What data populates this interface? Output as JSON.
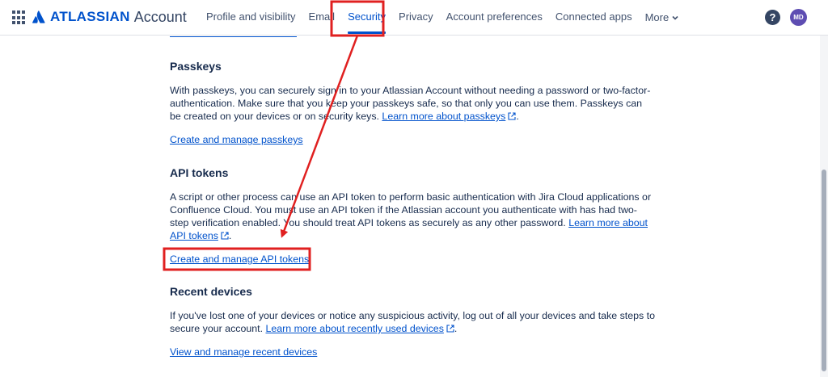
{
  "header": {
    "brand": "ATLASSIAN",
    "product": "Account",
    "nav": [
      {
        "label": "Profile and visibility"
      },
      {
        "label": "Email"
      },
      {
        "label": "Security"
      },
      {
        "label": "Privacy"
      },
      {
        "label": "Account preferences"
      },
      {
        "label": "Connected apps"
      },
      {
        "label": "More"
      }
    ],
    "help_glyph": "?",
    "avatar_initials": "MD"
  },
  "sections": {
    "passkeys": {
      "title": "Passkeys",
      "body": "With passkeys, you can securely sign in to your Atlassian Account without needing a password or two-factor-authentication. Make sure that you keep your passkeys safe, so that only you can use them. Passkeys can be created on your devices or on security keys.",
      "learn_more": "Learn more about passkeys",
      "action": "Create and manage passkeys"
    },
    "api_tokens": {
      "title": "API tokens",
      "body": "A script or other process can use an API token to perform basic authentication with Jira Cloud applications or Confluence Cloud. You must use an API token if the Atlassian account you authenticate with has had two-step verification enabled. You should treat API tokens as securely as any other password.",
      "learn_more": "Learn more about API tokens",
      "action": "Create and manage API tokens"
    },
    "recent_devices": {
      "title": "Recent devices",
      "body": "If you've lost one of your devices or notice any suspicious activity, log out of all your devices and take steps to secure your account.",
      "learn_more": "Learn more about recently used devices",
      "action": "View and manage recent devices"
    }
  },
  "colors": {
    "accent": "#0052cc",
    "annotation": "#e02020",
    "avatar": "#5e4db2"
  }
}
